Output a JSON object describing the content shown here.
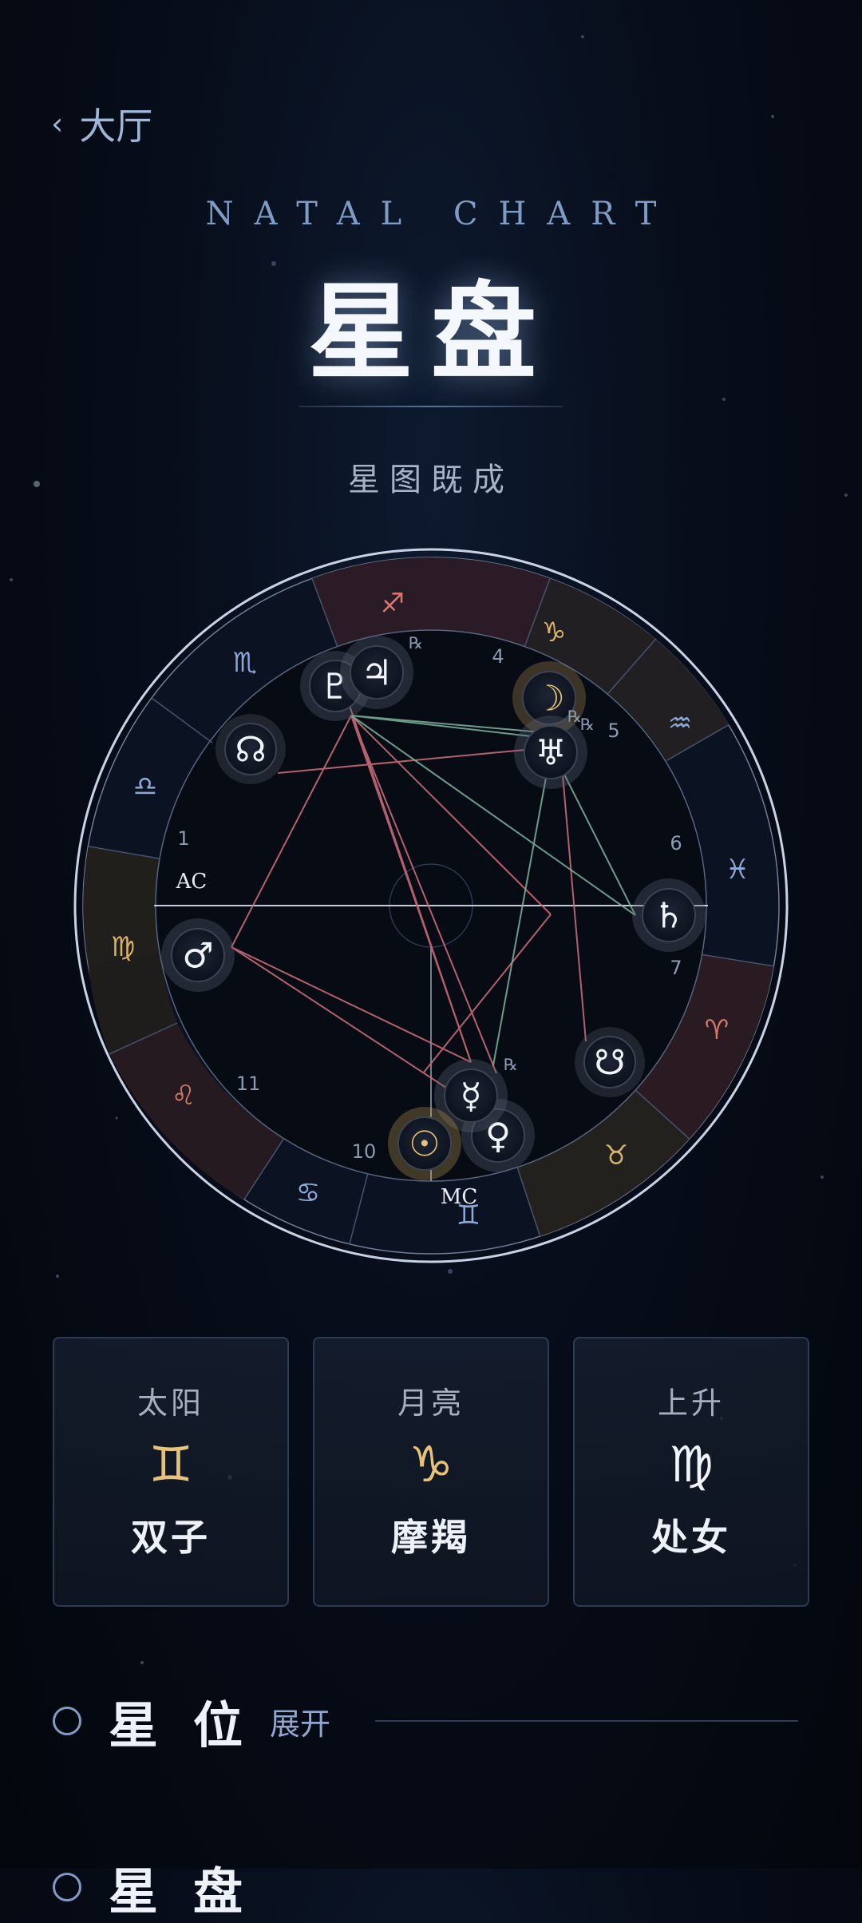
{
  "nav": {
    "back_label": "大厅"
  },
  "header": {
    "kicker": "NATAL CHART",
    "title": "星盘",
    "subtitle": "星图既成"
  },
  "chart": {
    "angles": {
      "ascendant": "AC",
      "midheaven": "MC"
    },
    "signs": [
      {
        "name": "sagittarius-icon",
        "glyph": "♐",
        "color": "#d7786e"
      },
      {
        "name": "capricorn-icon",
        "glyph": "♑",
        "color": "#d8b26a"
      },
      {
        "name": "aquarius-icon",
        "glyph": "♒",
        "color": "#8ea8d8"
      },
      {
        "name": "pisces-icon",
        "glyph": "♓",
        "color": "#8ea8d8"
      },
      {
        "name": "aries-icon",
        "glyph": "♈",
        "color": "#d7786e"
      },
      {
        "name": "taurus-icon",
        "glyph": "♉",
        "color": "#d8b26a"
      },
      {
        "name": "gemini-icon",
        "glyph": "♊",
        "color": "#8ea8d8"
      },
      {
        "name": "cancer-icon",
        "glyph": "♋",
        "color": "#8ea8d8"
      },
      {
        "name": "leo-icon",
        "glyph": "♌",
        "color": "#d7786e"
      },
      {
        "name": "virgo-icon",
        "glyph": "♍",
        "color": "#d8b26a"
      },
      {
        "name": "libra-icon",
        "glyph": "♎",
        "color": "#8ea8d8"
      },
      {
        "name": "scorpio-icon",
        "glyph": "♏",
        "color": "#8ea8d8"
      }
    ],
    "house_numbers": [
      "1",
      "4",
      "5",
      "6",
      "7",
      "10",
      "11"
    ],
    "planets": [
      {
        "name": "pluto-icon",
        "glyph": "♇",
        "retrograde": false
      },
      {
        "name": "jupiter-icon",
        "glyph": "♃",
        "retrograde": true
      },
      {
        "name": "moon-icon",
        "glyph": "☽",
        "retrograde": true
      },
      {
        "name": "uranus-icon",
        "glyph": "♅",
        "retrograde": true
      },
      {
        "name": "north-node-icon",
        "glyph": "☊",
        "retrograde": false
      },
      {
        "name": "saturn-icon",
        "glyph": "♄",
        "retrograde": false
      },
      {
        "name": "mars-icon",
        "glyph": "♂",
        "retrograde": false
      },
      {
        "name": "south-node-icon",
        "glyph": "☋",
        "retrograde": false
      },
      {
        "name": "mercury-icon",
        "glyph": "☿",
        "retrograde": true
      },
      {
        "name": "venus-icon",
        "glyph": "♀",
        "retrograde": false
      },
      {
        "name": "sun-icon",
        "glyph": "☉",
        "retrograde": false
      }
    ],
    "retrograde_mark": "℞",
    "aspect_colors": {
      "hard": "#c96a78",
      "soft": "#7fb6a0"
    }
  },
  "big_three": [
    {
      "label": "太阳",
      "glyph": "♊",
      "sign": "双子",
      "glyph_color": "#e8c27a"
    },
    {
      "label": "月亮",
      "glyph": "♑",
      "sign": "摩羯",
      "glyph_color": "#e8c27a"
    },
    {
      "label": "上升",
      "glyph": "♍",
      "sign": "处女",
      "glyph_color": "#f2f5fa"
    }
  ],
  "sections": [
    {
      "title": "星位",
      "toggle": "展开"
    },
    {
      "title": "星盘"
    }
  ]
}
